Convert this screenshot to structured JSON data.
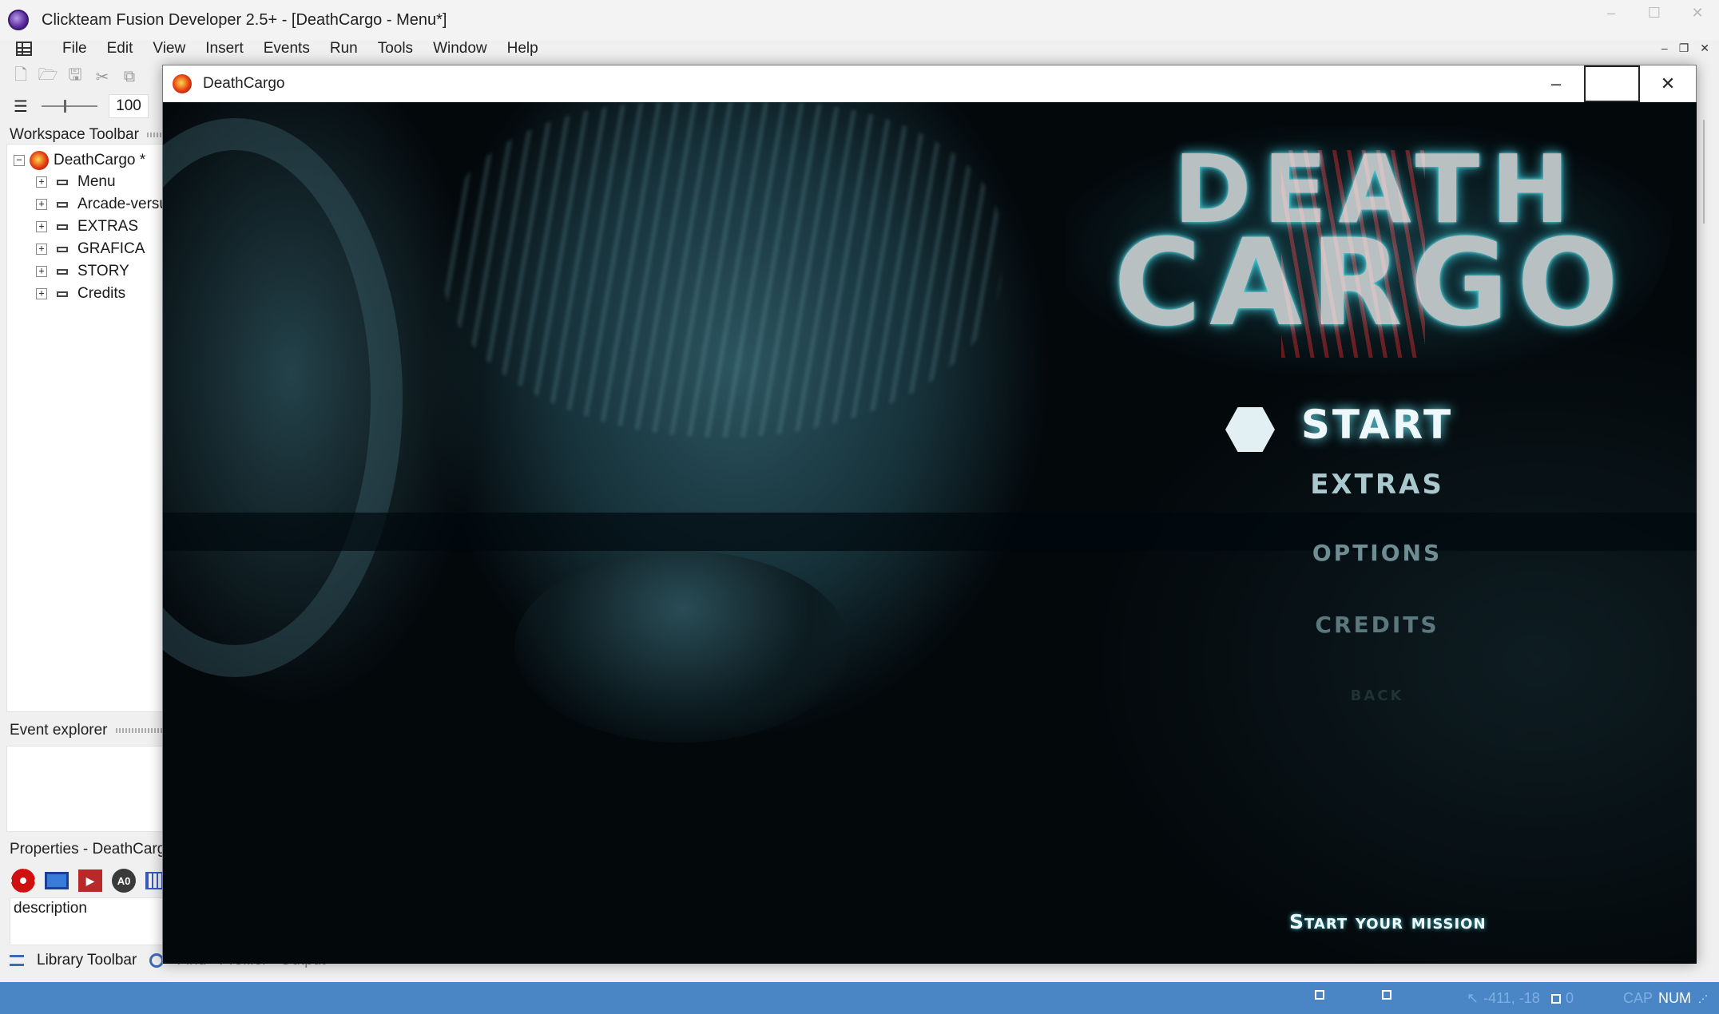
{
  "app": {
    "title": "Clickteam Fusion Developer 2.5+ - [DeathCargo - Menu*]",
    "window_controls": [
      "–",
      "☐",
      "✕"
    ]
  },
  "menubar": {
    "items": [
      "File",
      "Edit",
      "View",
      "Insert",
      "Events",
      "Run",
      "Tools",
      "Window",
      "Help"
    ],
    "mdi_controls": [
      "–",
      "❐",
      "✕"
    ]
  },
  "toolbar": {
    "icons": [
      "new-file-icon",
      "open-folder-icon",
      "save-icon",
      "cut-icon",
      "copy-icon"
    ],
    "zoom_value": "100"
  },
  "workspace": {
    "header": "Workspace Toolbar",
    "root": "DeathCargo *",
    "frames": [
      "Menu",
      "Arcade-versu",
      "EXTRAS",
      "GRAFICA",
      "STORY",
      "Credits"
    ]
  },
  "event_explorer": {
    "header": "Event explorer"
  },
  "properties": {
    "header": "Properties - DeathCarg",
    "description_label": "description"
  },
  "bottom_tabs": {
    "library": "Library Toolbar",
    "find": "Find",
    "profiler": "Profiler",
    "output": "Output"
  },
  "statusbar": {
    "coords": "-411, -18",
    "count": "0",
    "cap": "CAP",
    "num": "NUM"
  },
  "game_window": {
    "title": "DeathCargo",
    "controls": [
      "–",
      "☐",
      "✕"
    ],
    "logo_line1": "DEATH",
    "logo_line2": "CARGO",
    "menu": {
      "start": "START",
      "extras": "EXTRAS",
      "options": "OPTIONS",
      "credits": "CREDITS",
      "back": "BACK"
    },
    "hint": "Start your mission"
  }
}
